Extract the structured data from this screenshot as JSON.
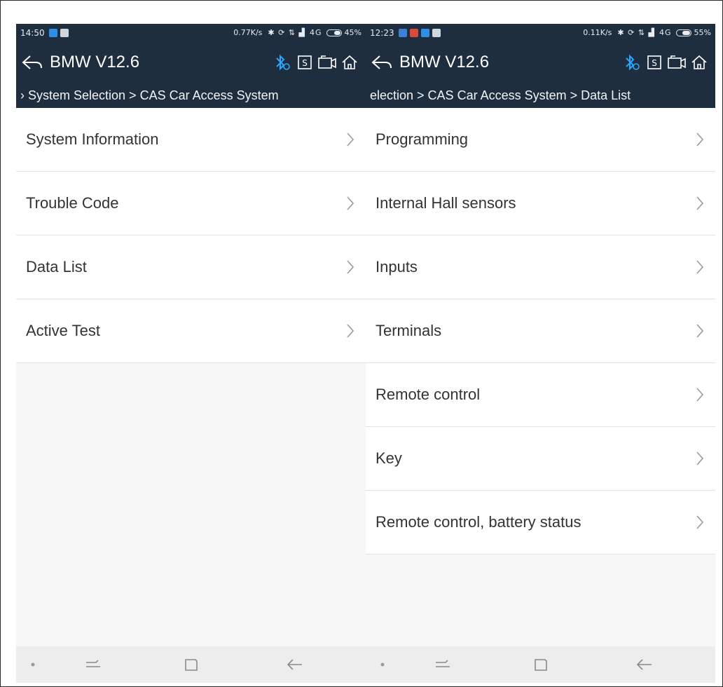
{
  "left_screen": {
    "status": {
      "time": "14:50",
      "net_speed": "0.77K/s",
      "network": "4G",
      "battery_pct": "45%",
      "battery_level": 0.45
    },
    "app": {
      "title": "BMW V12.6"
    },
    "breadcrumb": "› System Selection > CAS Car Access System",
    "items": [
      {
        "label": "System Information"
      },
      {
        "label": "Trouble Code"
      },
      {
        "label": "Data List"
      },
      {
        "label": "Active Test"
      }
    ]
  },
  "right_screen": {
    "status": {
      "time": "12:23",
      "net_speed": "0.11K/s",
      "network": "4G",
      "battery_pct": "55%",
      "battery_level": 0.55
    },
    "app": {
      "title": "BMW V12.6"
    },
    "breadcrumb": "election > CAS Car Access System > Data List",
    "items": [
      {
        "label": "Programming"
      },
      {
        "label": "Internal Hall sensors"
      },
      {
        "label": "Inputs"
      },
      {
        "label": "Terminals"
      },
      {
        "label": "Remote control"
      },
      {
        "label": "Key"
      },
      {
        "label": "Remote control, battery status"
      }
    ]
  },
  "colors": {
    "header_bg": "#1e2e3f",
    "bluetooth_accent": "#2aa7ff",
    "list_bg": "#ffffff",
    "divider": "#e2e2e2",
    "navbar_bg": "#ededed"
  },
  "icons": {
    "back": "back-arrow-icon",
    "bluetooth": "bluetooth-icon",
    "screenshot": "s-tile-icon",
    "record": "video-camera-icon",
    "home": "home-icon",
    "chevron": "chevron-right-icon",
    "nav_menu": "menu-lines-icon",
    "nav_home": "square-home-icon",
    "nav_back": "back-arrow-nav-icon"
  }
}
